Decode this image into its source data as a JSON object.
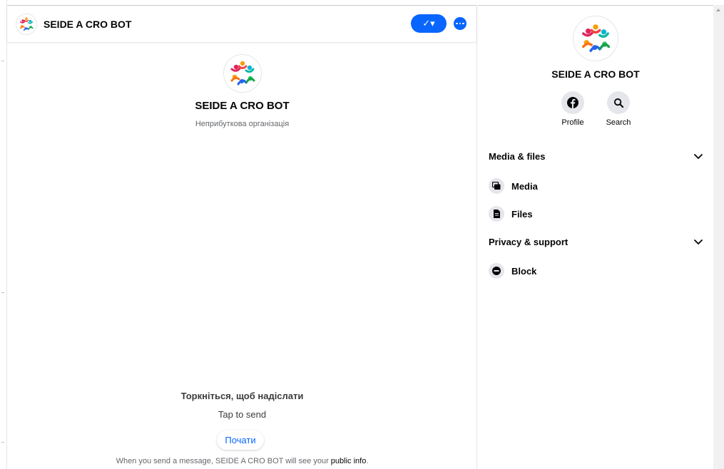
{
  "chat": {
    "header_name": "SEIDE A CRO BOT",
    "page_name": "SEIDE A CRO BOT",
    "page_category": "Неприбуткова організація",
    "tap_ua": "Торкніться, щоб надіслати",
    "tap_en": "Tap to send",
    "start_button": "Почати",
    "notice_prefix": "When you send a message, SEIDE A CRO BOT will see your ",
    "notice_link": "public info",
    "notice_suffix": "."
  },
  "header_actions": {
    "check_label": "✓▾"
  },
  "sidebar": {
    "name": "SEIDE A CRO BOT",
    "actions": [
      {
        "label": "Profile",
        "icon": "facebook-icon"
      },
      {
        "label": "Search",
        "icon": "search-icon"
      }
    ],
    "media_section": {
      "title": "Media & files"
    },
    "media_items": [
      {
        "label": "Media",
        "icon": "media-icon"
      },
      {
        "label": "Files",
        "icon": "file-icon"
      }
    ],
    "privacy_section": {
      "title": "Privacy & support"
    },
    "privacy_items": [
      {
        "label": "Block",
        "icon": "block-icon"
      }
    ]
  },
  "colors": {
    "accent": "#0866ff",
    "text": "#050505",
    "secondary_text": "#65676b",
    "icon_bg": "#e4e6eb"
  }
}
